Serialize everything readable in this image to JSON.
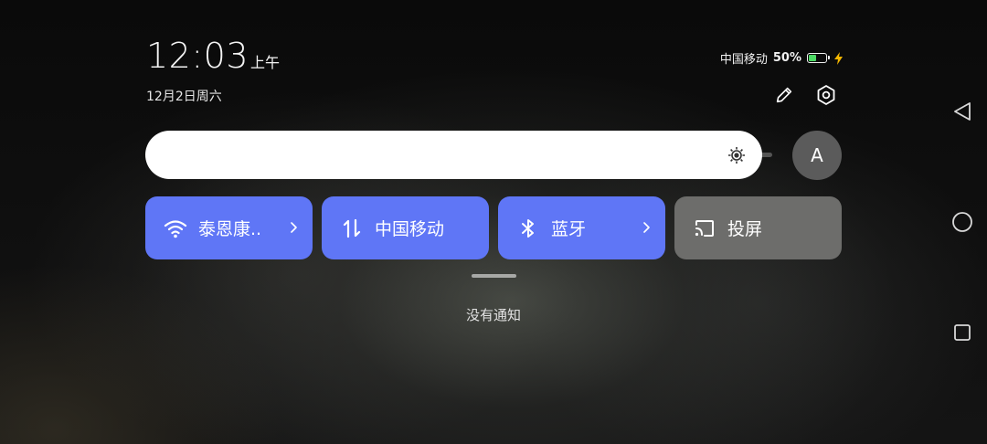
{
  "header": {
    "time": "12:03",
    "ampm": "上午",
    "date": "12月2日周六"
  },
  "status_bar": {
    "carrier": "中国移动",
    "battery_percent_label": "50%",
    "battery_level": 0.5,
    "charging": true,
    "battery_color": "#4cd964",
    "bolt_color": "#f5b700"
  },
  "actions": {
    "edit_icon": "pencil-icon",
    "settings_icon": "gear-icon"
  },
  "brightness": {
    "icon": "sun-icon",
    "level": 0.9
  },
  "auto_brightness": {
    "label": "A"
  },
  "tiles": [
    {
      "label": "泰恩康..",
      "icon": "wifi-icon",
      "active": true,
      "has_chevron": true
    },
    {
      "label": "中国移动",
      "icon": "mobile-data-icon",
      "active": true,
      "has_chevron": false
    },
    {
      "label": "蓝牙",
      "icon": "bluetooth-icon",
      "active": true,
      "has_chevron": true
    },
    {
      "label": "投屏",
      "icon": "cast-icon",
      "active": false,
      "has_chevron": false
    }
  ],
  "notifications": {
    "empty_text": "没有通知"
  },
  "navigation": {
    "back_icon": "back-triangle-icon",
    "home_icon": "home-circle-icon",
    "recents_icon": "recents-square-icon"
  },
  "colors": {
    "tile_active": "#5f76f6",
    "tile_inactive": "#6d6d6b",
    "brightness_bar": "#ffffff",
    "auto_button": "#5b5b5b"
  }
}
